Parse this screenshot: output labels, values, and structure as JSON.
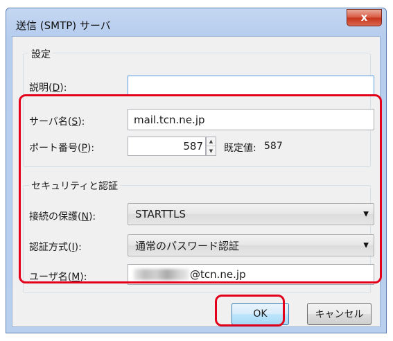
{
  "window": {
    "title": "送信 (SMTP) サーバ",
    "close_glyph": "x"
  },
  "settings": {
    "group_label": "設定",
    "description_label": "説明(",
    "description_key": "D",
    "description_suffix": "):",
    "description_value": "",
    "server_label": "サーバ名(",
    "server_key": "S",
    "server_suffix": "):",
    "server_value": "mail.tcn.ne.jp",
    "port_label": "ポート番号(",
    "port_key": "P",
    "port_suffix": "):",
    "port_value": "587",
    "default_label": "既定値:",
    "default_value": "587"
  },
  "security": {
    "group_label": "セキュリティと認証",
    "connection_label": "接続の保護(",
    "connection_key": "N",
    "connection_suffix": "):",
    "connection_value": "STARTTLS",
    "auth_label": "認証方式(",
    "auth_key": "I",
    "auth_suffix": "):",
    "auth_value": "通常のパスワード認証",
    "user_label": "ユーザ名(",
    "user_key": "M",
    "user_suffix": "):",
    "user_value_visible": "@tcn.ne.jp"
  },
  "buttons": {
    "ok": "OK",
    "cancel": "キャンセル"
  },
  "colors": {
    "highlight": "#e3001b",
    "title_bar": "#b9cfee",
    "dialog_bg": "#f0f0f0"
  }
}
